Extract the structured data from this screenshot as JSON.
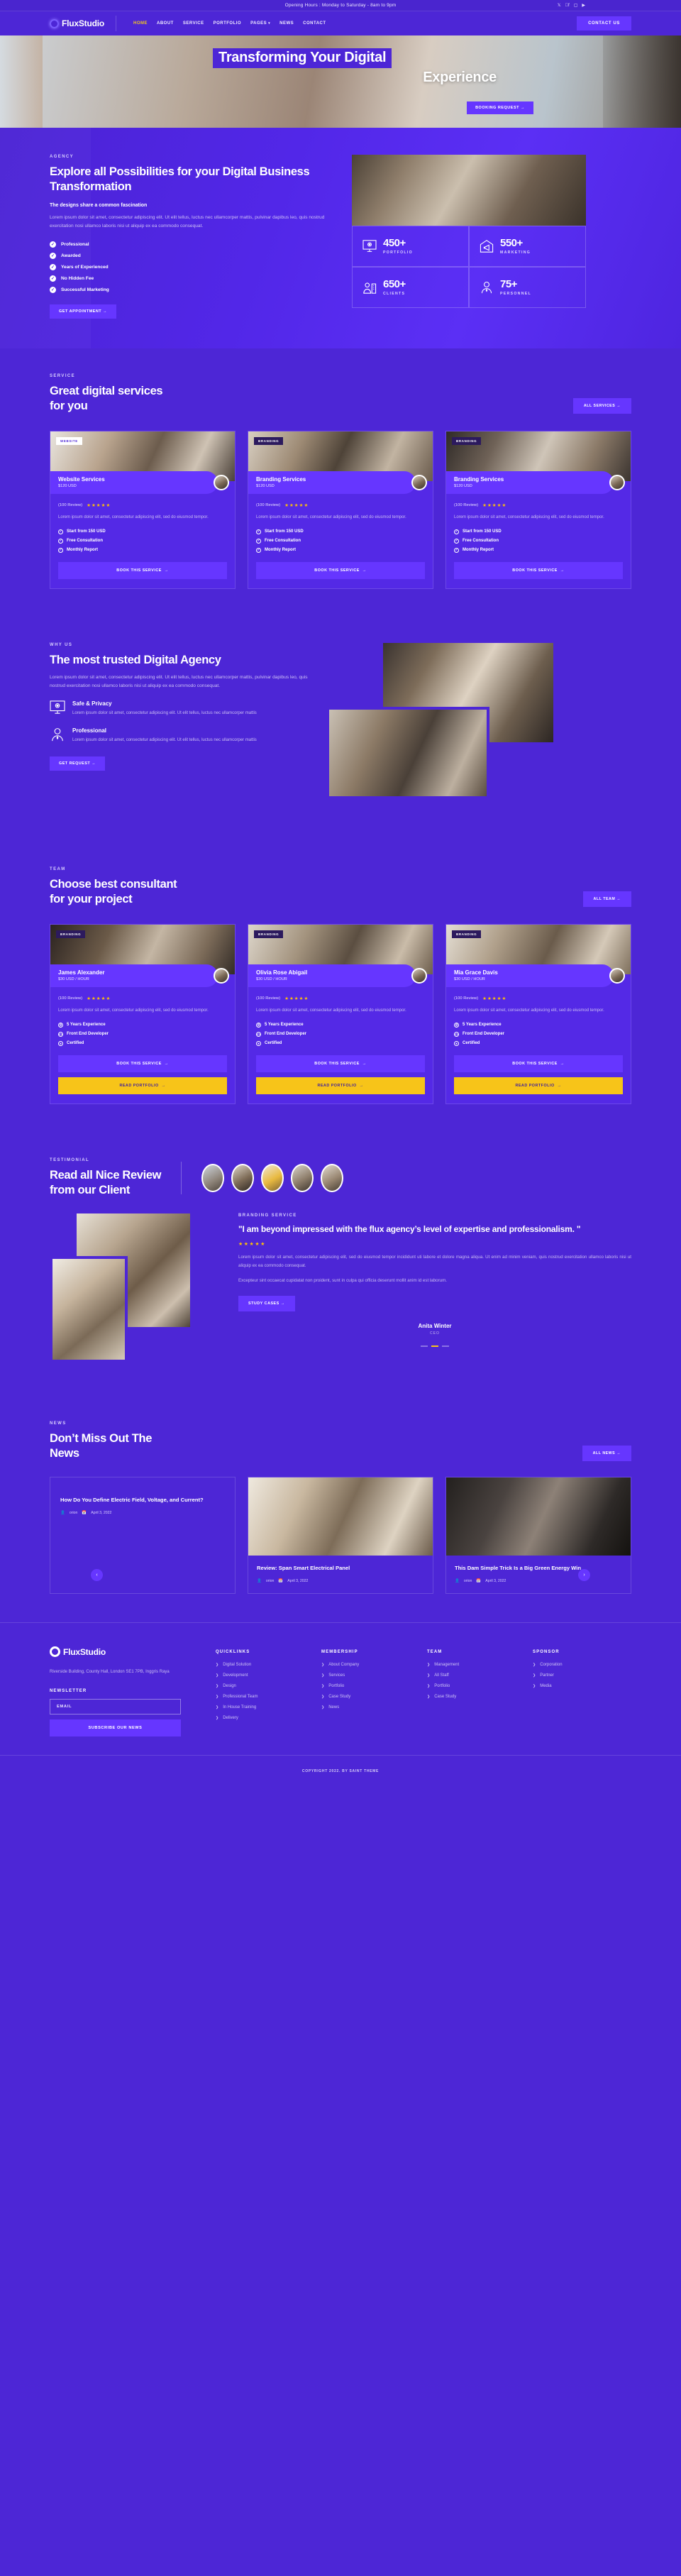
{
  "topbar": {
    "hours": "Opening Hours : Monday to Saturday - 8am to 9pm",
    "socials": [
      "twitter-icon",
      "facebook-icon",
      "instagram-icon",
      "youtube-icon"
    ]
  },
  "header": {
    "brand": "FluxStudio",
    "nav": [
      {
        "label": "HOME",
        "active": true
      },
      {
        "label": "ABOUT",
        "active": false
      },
      {
        "label": "SERVICE",
        "active": false
      },
      {
        "label": "PORTFOLIO",
        "active": false
      },
      {
        "label": "PAGES",
        "active": false,
        "caret": "▾"
      },
      {
        "label": "NEWS",
        "active": false
      },
      {
        "label": "CONTACT",
        "active": false
      }
    ],
    "cta": "CONTACT US"
  },
  "hero": {
    "title_line1": "Transforming Your Digital",
    "title_line2": "Experience",
    "cta": "BOOKING REQUEST →"
  },
  "agency": {
    "eyebrow": "AGENCY",
    "title": "Explore all Possibilities for your Digital Business Transformation",
    "lead": "The designs share a common fascination",
    "para": "Lorem ipsum dolor sit amet, consectetur adipiscing elit. Ut elit tellus, luctus nec ullamcorper mattis, pulvinar dapibus leo, quis nostrud exercitation nosi ullamco laboris nisi ut aliquip ex ea commodo consequat.",
    "checks": [
      "Professional",
      "Awarded",
      "Years of Experienced",
      "No Hidden Fee",
      "Successful Marketing"
    ],
    "cta": "GET APPOINTMENT →",
    "stats": [
      {
        "num": "450+",
        "label": "PORTFOLIO",
        "icon": "monitor-icon"
      },
      {
        "num": "550+",
        "label": "MARKETING",
        "icon": "megaphone-house-icon"
      },
      {
        "num": "650+",
        "label": "CLIENTS",
        "icon": "client-badge-icon"
      },
      {
        "num": "75+",
        "label": "PERSONNEL",
        "icon": "person-tie-icon"
      }
    ]
  },
  "service": {
    "eyebrow": "SERVICE",
    "title_line1": "Great digital services",
    "title_line2": "for you",
    "cta": "ALL SERVICES →",
    "cards": [
      {
        "tag": "WEBSITE",
        "title": "Website Services",
        "price": "$120 USD",
        "reviews": "(100 Review)",
        "stars": "★★★★★",
        "desc": "Lorem ipsum dolor sit amet, consectetur adipiscing elit, sed do eiusmod tempor.",
        "features": [
          "Start from 150 USD",
          "Free Consultation",
          "Monthly Report"
        ],
        "cta": "BOOK THIS SERVICE"
      },
      {
        "tag": "BRANDING",
        "title": "Branding Services",
        "price": "$120 USD",
        "reviews": "(100 Review)",
        "stars": "★★★★★",
        "desc": "Lorem ipsum dolor sit amet, consectetur adipiscing elit, sed do eiusmod tempor.",
        "features": [
          "Start from 150 USD",
          "Free Consultation",
          "Monthly Report"
        ],
        "cta": "BOOK THIS SERVICE"
      },
      {
        "tag": "BRANDING",
        "title": "Branding Services",
        "price": "$120 USD",
        "reviews": "(100 Review)",
        "stars": "★★★★★",
        "desc": "Lorem ipsum dolor sit amet, consectetur adipiscing elit, sed do eiusmod tempor.",
        "features": [
          "Start from 150 USD",
          "Free Consultation",
          "Monthly Report"
        ],
        "cta": "BOOK THIS SERVICE"
      }
    ]
  },
  "whyus": {
    "eyebrow": "WHY US",
    "title": "The most trusted Digital Agency",
    "para": "Lorem ipsum dolor sit amet, consectetur adipiscing elit. Ut elit tellus, luctus nec ullamcorper mattis, pulvinar dapibus leo, quis nostrud exercitation nosi ullamco laboris nisi ut aliquip ex ea commodo consequat.",
    "features": [
      {
        "title": "Safe & Privacy",
        "desc": "Lorem ipsum dolor sit amet, consectetur adipiscing elit. Ut elit tellus, luctus nec ullamcorper mattis",
        "icon": "monitor-icon"
      },
      {
        "title": "Professional",
        "desc": "Lorem ipsum dolor sit amet, consectetur adipiscing elit. Ut elit tellus, luctus nec ullamcorper mattis",
        "icon": "person-tie-icon"
      }
    ],
    "cta": "GET REQUEST →"
  },
  "team": {
    "eyebrow": "TEAM",
    "title_line1": "Choose best consultant",
    "title_line2": "for your project",
    "cta": "ALL TEAM →",
    "members": [
      {
        "tag": "BRANDING",
        "name": "James Alexander",
        "rate": "$30 USD / HOUR",
        "reviews": "(100 Review)",
        "stars": "★★★★★",
        "desc": "Lorem ipsum dolor sit amet, consectetur adipiscing elit, sed do eiusmod tempor.",
        "features": [
          "5 Years Experience",
          "Front End Developer",
          "Certified"
        ],
        "cta_book": "BOOK THIS SERVICE",
        "cta_portfolio": "READ PORTFOLIO"
      },
      {
        "tag": "BRANDING",
        "name": "Olivia Rose Abigail",
        "rate": "$30 USD / HOUR",
        "reviews": "(100 Review)",
        "stars": "★★★★★",
        "desc": "Lorem ipsum dolor sit amet, consectetur adipiscing elit, sed do eiusmod tempor.",
        "features": [
          "5 Years Experience",
          "Front End Developer",
          "Certified"
        ],
        "cta_book": "BOOK THIS SERVICE",
        "cta_portfolio": "READ PORTFOLIO"
      },
      {
        "tag": "BRANDING",
        "name": "Mia Grace Davis",
        "rate": "$30 USD / HOUR",
        "reviews": "(100 Review)",
        "stars": "★★★★★",
        "desc": "Lorem ipsum dolor sit amet, consectetur adipiscing elit, sed do eiusmod tempor.",
        "features": [
          "5 Years Experience",
          "Front End Developer",
          "Certified"
        ],
        "cta_book": "BOOK THIS SERVICE",
        "cta_portfolio": "READ PORTFOLIO"
      }
    ]
  },
  "testimonial": {
    "eyebrow": "TESTIMONIAL",
    "title_line1": "Read all Nice Review",
    "title_line2": "from our Client",
    "service_label": "BRANDING SERVICE",
    "quote": "\"I am beyond impressed with the flux agency’s level of expertise and professionalism. \"",
    "stars": "★★★★★",
    "para1": "Lorem ipsum dolor sit amet, consectetur adipiscing elit, sed do eiusmod tempor incididunt uti labore et dolore magna aliqua. Ut enim ad minim veniam, quis nostrud exercitation ullamco laboris nisi ut aliquip ex ea commodo consequat.",
    "para2": "Excepteur sint occaecat cupidatat non proident, sunt in culpa qui officia deserunt mollit anim id est laborum.",
    "cta": "STUDY CASES →",
    "author_name": "Anita Winter",
    "author_role": "CEO"
  },
  "news": {
    "eyebrow": "NEWS",
    "title_line1": "Don’t Miss Out The",
    "title_line2": "News",
    "cta": "ALL NEWS →",
    "prev": "‹",
    "next": "›",
    "items": [
      {
        "title": "How Do You Define Electric Field, Voltage, and Current?",
        "author": "orion",
        "date": "April 3, 2022"
      },
      {
        "title": "Review: Span Smart Electrical Panel",
        "author": "orion",
        "date": "April 3, 2022"
      },
      {
        "title": "This Dam Simple Trick Is a Big Green Energy Win",
        "author": "orion",
        "date": "April 3, 2022"
      }
    ]
  },
  "footer": {
    "brand": "FluxStudio",
    "address": "Riverside Building, County Hall, London SE1 7PB, Inggris Raya",
    "newsletter_label": "NEWSLETTER",
    "email_placeholder": "EMAIL",
    "email_value": "",
    "subscribe": "SUBSCRIBE OUR NEWS",
    "columns": [
      {
        "title": "QUICKLINKS",
        "links": [
          "Digital Solution",
          "Development",
          "Design",
          "Professional Team",
          "In House Training",
          "Delivery"
        ]
      },
      {
        "title": "MEMBERSHIP",
        "links": [
          "About Company",
          "Services",
          "Portfolio",
          "Case Study",
          "News"
        ]
      },
      {
        "title": "TEAM",
        "links": [
          "Management",
          "All Staff",
          "Portfolio",
          "Case Study"
        ]
      },
      {
        "title": "SPONSOR",
        "links": [
          "Corporation",
          "Partner",
          "Media"
        ]
      }
    ],
    "copyright": "COPYRIGHT 2022. BY SAINT THEME"
  },
  "colors": {
    "brand": "#4d26d6",
    "accent": "#6636ff",
    "yellow": "#f7c419",
    "star": "#ffc107"
  }
}
